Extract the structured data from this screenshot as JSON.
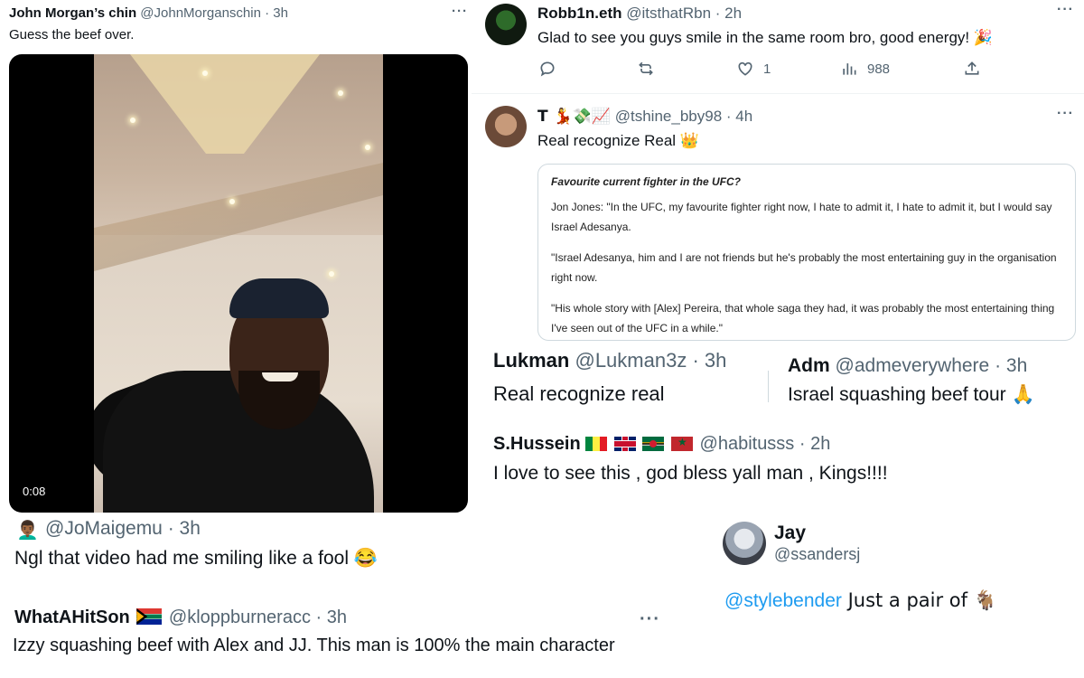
{
  "tweet_main": {
    "author_name": "John Morgan’s chin",
    "handle": "@JohnMorganschin",
    "time": "· 3h",
    "text": "Guess the beef over.",
    "more": "···",
    "video_time": "0:08"
  },
  "reply_jomaigemu": {
    "avatar_emoji": "👨🏾‍🦱",
    "handle": "@JoMaigemu",
    "time": "· 3h",
    "text": "Ngl that video had me smiling like a fool 😂"
  },
  "reply_whatahitson": {
    "author_name": "WhatAHitSon",
    "handle": "@kloppburneracc",
    "time": "· 3h",
    "text": "Izzy squashing beef with Alex and JJ. This man is 100% the main character",
    "more": "···"
  },
  "reply_robb1n": {
    "author_name": "Robb1n.eth",
    "handle": "@itsthatRbn",
    "time": "· 2h",
    "text": "Glad to see you guys smile in the same room bro, good energy! 🎉",
    "more": "···",
    "actions": {
      "like_count": "1",
      "view_count": "988"
    }
  },
  "reply_tshine": {
    "author_name": "T 💃💸📈",
    "handle": "@tshine_bby98",
    "time": "· 4h",
    "text": "Real recognize Real 👑",
    "more": "···",
    "quote": {
      "title": "Favourite current fighter in the UFC?",
      "p1": "Jon Jones: \"In the UFC, my favourite fighter right now, I hate to admit it, I hate to admit it, but I would say Israel Adesanya.",
      "p2": "\"Israel Adesanya, him and I are not friends but he's probably the most entertaining guy in the organisation right now.",
      "p3": "\"His whole story with [Alex] Pereira, that whole saga they had, it was probably the most entertaining thing I've seen out of the UFC in a while.\""
    }
  },
  "reply_lukman": {
    "author_name": "Lukman",
    "handle": "@Lukman3z",
    "time": "· 3h",
    "text": "Real recognize real"
  },
  "reply_adm": {
    "author_name": "Adm",
    "handle": "@admeverywhere",
    "time": "· 3h",
    "text": "Israel squashing beef tour 🙏"
  },
  "reply_hussein": {
    "author_name": "S.Hussein",
    "handle": "@habitusss",
    "time": "· 2h",
    "text": "I love to see this , god bless yall man , Kings!!!!"
  },
  "reply_jay": {
    "author_name": "Jay",
    "handle": "@ssandersj",
    "mention": "@stylebender",
    "text": " Just a pair of 🐐"
  }
}
